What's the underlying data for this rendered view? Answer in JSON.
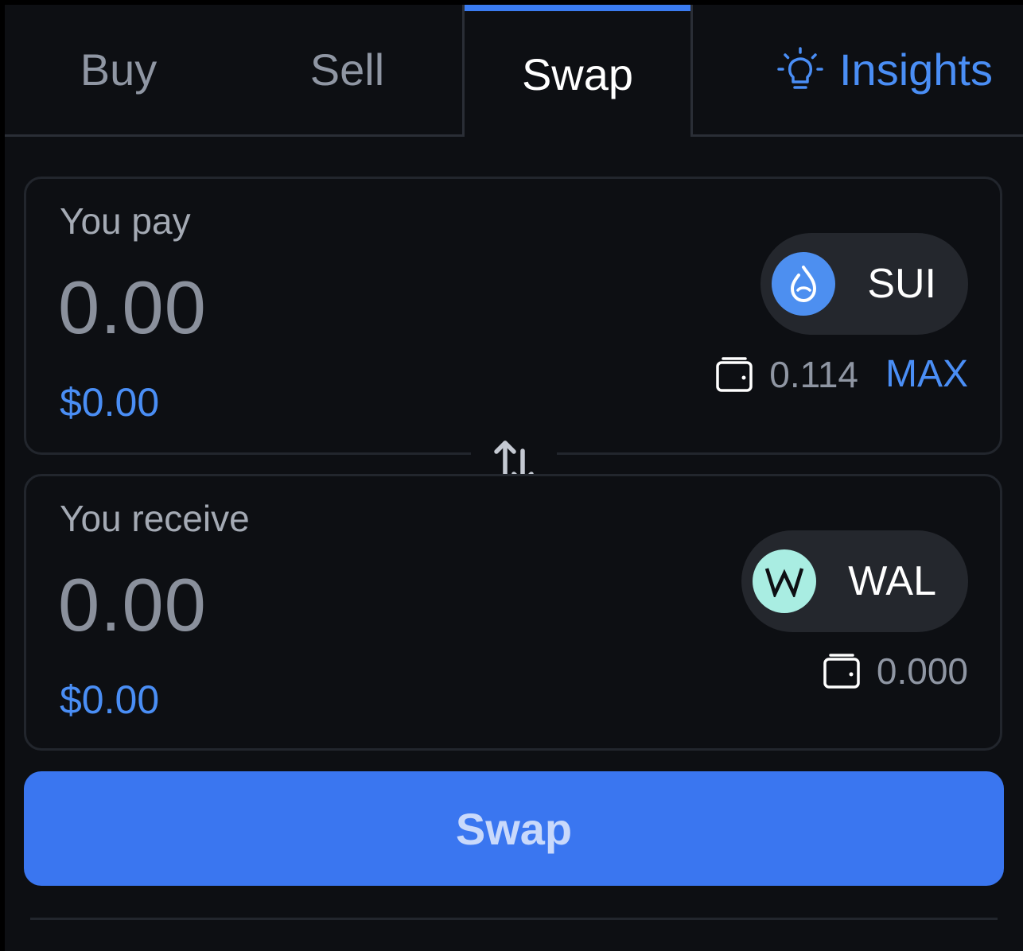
{
  "tabs": {
    "buy": "Buy",
    "sell": "Sell",
    "swap": "Swap",
    "insights": "Insights",
    "insights_icon": "lightbulb-icon",
    "active": "Swap"
  },
  "pay": {
    "label": "You pay",
    "amount": "0.00",
    "usd": "$0.00",
    "token": {
      "symbol": "SUI",
      "icon": "sui-droplet-icon",
      "icon_color": "#4d8ff0"
    },
    "balance": "0.114",
    "max_label": "MAX"
  },
  "receive": {
    "label": "You receive",
    "amount": "0.00",
    "usd": "$0.00",
    "token": {
      "symbol": "WAL",
      "icon": "walrus-w-icon",
      "icon_color": "#a9ede2"
    },
    "balance": "0.000"
  },
  "switch_icon": "swap-arrows-icon",
  "action": {
    "label": "Swap"
  },
  "colors": {
    "accent": "#3a76f0",
    "link": "#4a8ef5",
    "background": "#0d0f13",
    "pill": "#24272d"
  }
}
